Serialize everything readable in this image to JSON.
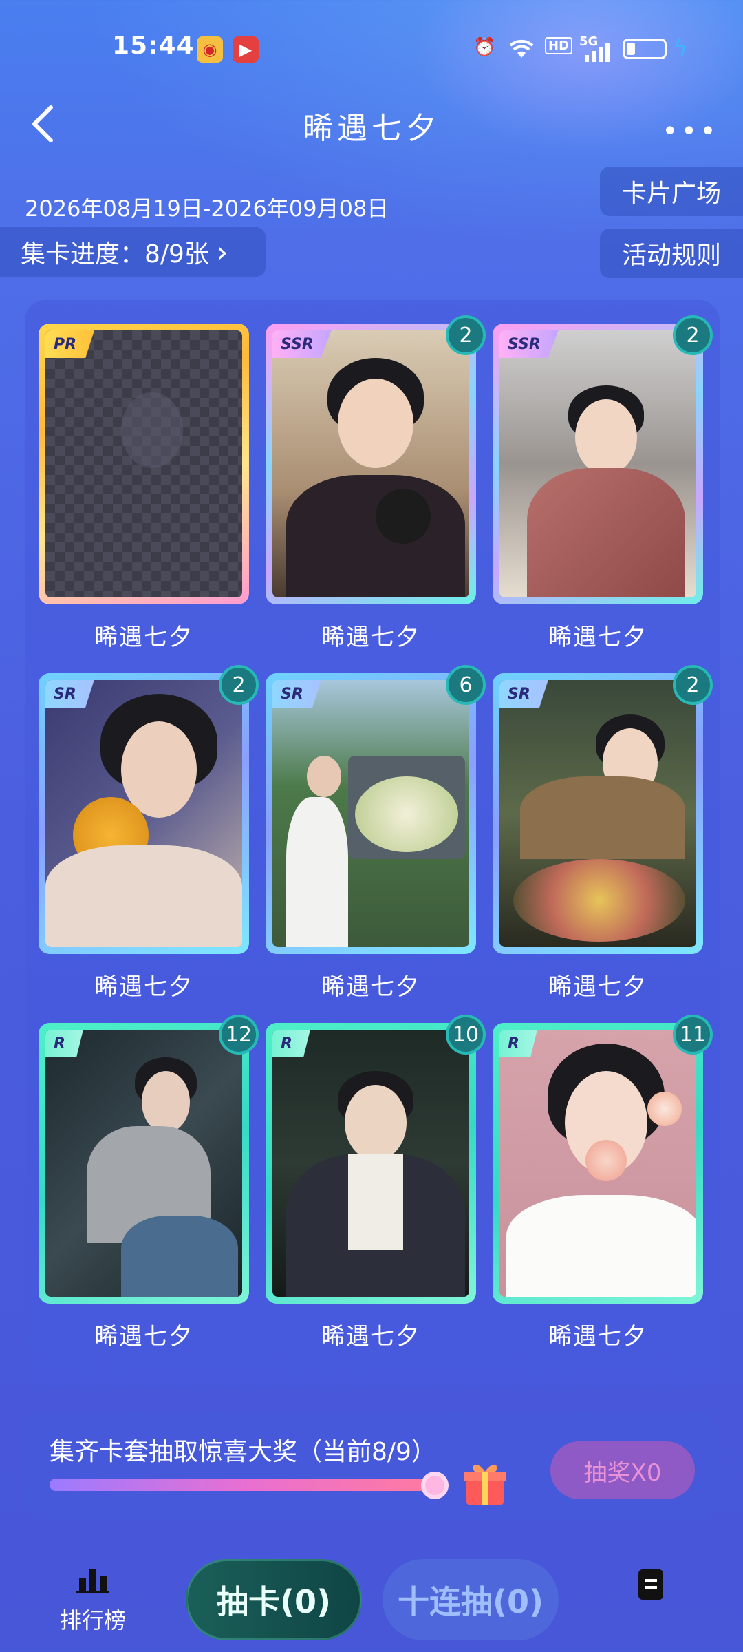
{
  "status_bar": {
    "time": "15:44",
    "hd": "HD",
    "signal": "5G",
    "icons": [
      "weibo-icon",
      "video-icon",
      "alarm-icon",
      "wifi-icon",
      "battery-icon",
      "charging-icon"
    ]
  },
  "header": {
    "title": "晞遇七夕",
    "more": "•••"
  },
  "date_range": "2026年08月19日-2026年09月08日",
  "side_buttons": {
    "plaza": "卡片广场",
    "rules": "活动规则"
  },
  "progress": {
    "label": "集卡进度：8/9张",
    "arrow": "›"
  },
  "cards": [
    {
      "rarity": "PR",
      "label": "晞遇七夕",
      "count": "",
      "locked": true
    },
    {
      "rarity": "SSR",
      "label": "晞遇七夕",
      "count": "2"
    },
    {
      "rarity": "SSR",
      "label": "晞遇七夕",
      "count": "2"
    },
    {
      "rarity": "SR",
      "label": "晞遇七夕",
      "count": "2"
    },
    {
      "rarity": "SR",
      "label": "晞遇七夕",
      "count": "6"
    },
    {
      "rarity": "SR",
      "label": "晞遇七夕",
      "count": "2"
    },
    {
      "rarity": "R",
      "label": "晞遇七夕",
      "count": "12"
    },
    {
      "rarity": "R",
      "label": "晞遇七夕",
      "count": "10"
    },
    {
      "rarity": "R",
      "label": "晞遇七夕",
      "count": "11"
    }
  ],
  "prize": {
    "text": "集齐卡套抽取惊喜大奖（当前8/9）",
    "progress": 0.889,
    "button": "抽奖X0"
  },
  "bottom_nav": {
    "rank": "排行榜",
    "draw": "抽卡(0)",
    "ten_draw": "十连抽(0)"
  }
}
